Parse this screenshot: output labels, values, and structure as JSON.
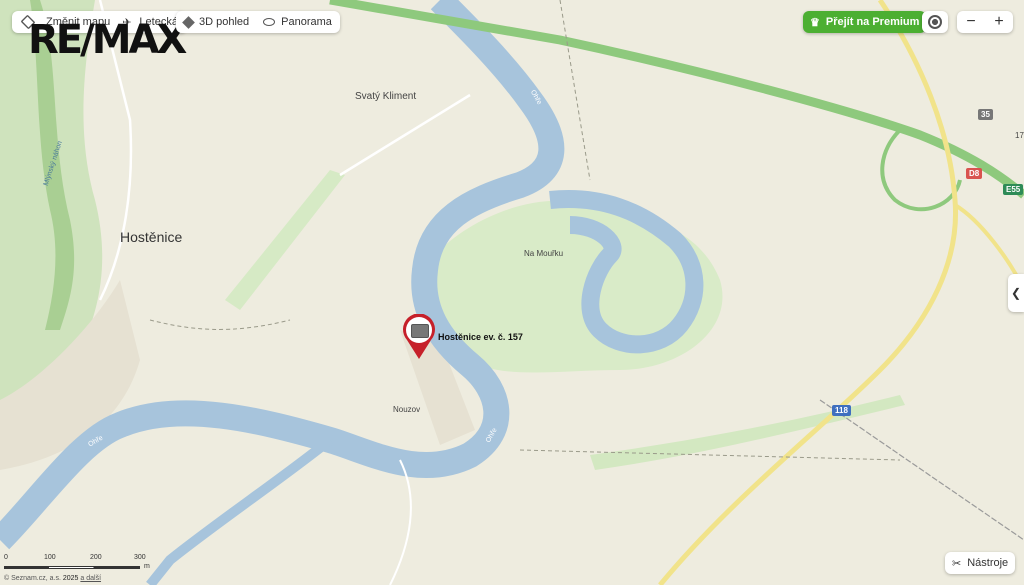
{
  "toolbar": {
    "change_map": "Změnit mapu",
    "aerial": "Letecká",
    "view_3d": "3D pohled",
    "panorama": "Panorama",
    "premium": "Přejít na Premium"
  },
  "logo": "RE/MAX",
  "labels": {
    "village": "Hostěnice",
    "svaty_kliment": "Svatý Kliment",
    "na_mourku": "Na Mouřku",
    "nouzov": "Nouzov",
    "river": "Ohře",
    "river2": "Ohře",
    "river3": "Ohře",
    "stream": "Mlýnský náhon",
    "pin": "Hostěnice ev. č. 157"
  },
  "road_shields": {
    "d8": "D8",
    "e55": "E55",
    "r35": "35",
    "r118": "118",
    "partial": "17"
  },
  "scale": {
    "ticks": [
      "0",
      "100",
      "200",
      "300"
    ],
    "unit": "m"
  },
  "attribution": {
    "text": "© Seznam.cz, a.s.",
    "year": "2025",
    "more": "a další"
  },
  "tools": {
    "label": "Nástroje"
  },
  "colors": {
    "land": "#eeecdf",
    "water": "#a7c4dc",
    "forest": "#cfe3bd",
    "motorway": "#8ec97d",
    "main_road": "#f1e38a",
    "premium_green": "#4caf32",
    "pin_red": "#c6202a"
  }
}
